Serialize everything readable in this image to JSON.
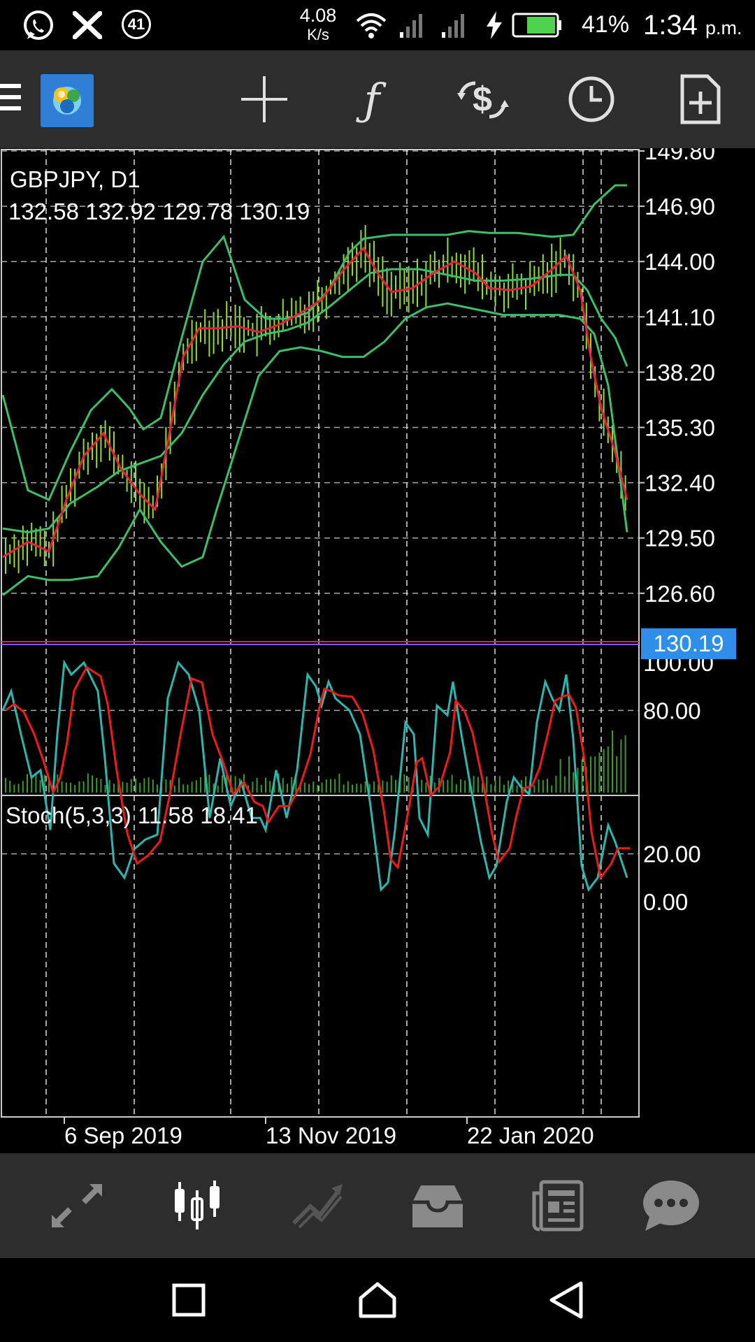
{
  "status_bar": {
    "notification_count": "41",
    "net_speed_value": "4.08",
    "net_speed_unit": "K/s",
    "battery": "41%",
    "time": "1:34",
    "ampm": "p.m."
  },
  "toolbar": {
    "icons": [
      "menu-icon",
      "app-logo",
      "crosshair-icon",
      "function-icon",
      "trade-icon",
      "clock-icon",
      "new-document-icon"
    ]
  },
  "chart": {
    "symbol": "GBPJPY, D1",
    "ohlc": "132.58 132.92 129.78 130.19",
    "current_price": "130.19",
    "price_axis": [
      "149.80",
      "146.90",
      "144.00",
      "141.10",
      "138.20",
      "135.30",
      "132.40",
      "129.50",
      "126.60"
    ],
    "stoch_label": "Stoch(5,3,3) 11.58 18.41",
    "stoch_axis": [
      "100.00",
      "80.00",
      "20.00",
      "0.00"
    ],
    "time_axis": [
      "6 Sep 2019",
      "13 Nov 2019",
      "22 Jan 2020"
    ],
    "colors": {
      "price_line": "#e8203a",
      "bands": "#3cbf6a",
      "candles": "#8ee02a",
      "stoch_main": "#2bb7b0",
      "stoch_signal": "#ee1b1b",
      "price_tag": "#2f8fe8"
    }
  },
  "chart_data": {
    "type": "line",
    "symbol": "GBPJPY",
    "timeframe": "D1",
    "x": [
      "6 Sep 2019",
      "13 Nov 2019",
      "22 Jan 2020"
    ],
    "ylim": [
      125.0,
      151.0
    ],
    "yticks": [
      149.8,
      146.9,
      144.0,
      141.1,
      138.2,
      135.3,
      132.4,
      129.5,
      126.6
    ],
    "last_close": 130.19,
    "ohlc_last": {
      "open": 132.58,
      "high": 132.92,
      "low": 129.78,
      "close": 130.19
    },
    "stochastic": {
      "params": "5,3,3",
      "main": 11.58,
      "signal": 18.41,
      "levels": [
        80,
        20
      ],
      "ylim": [
        0,
        100
      ]
    }
  },
  "bottom_nav": {
    "items": [
      "quotes-icon",
      "chart-icon",
      "trade-icon",
      "history-icon",
      "news-icon",
      "chat-icon"
    ]
  },
  "system_nav": {
    "items": [
      "recent-apps-icon",
      "home-icon",
      "back-icon"
    ]
  }
}
